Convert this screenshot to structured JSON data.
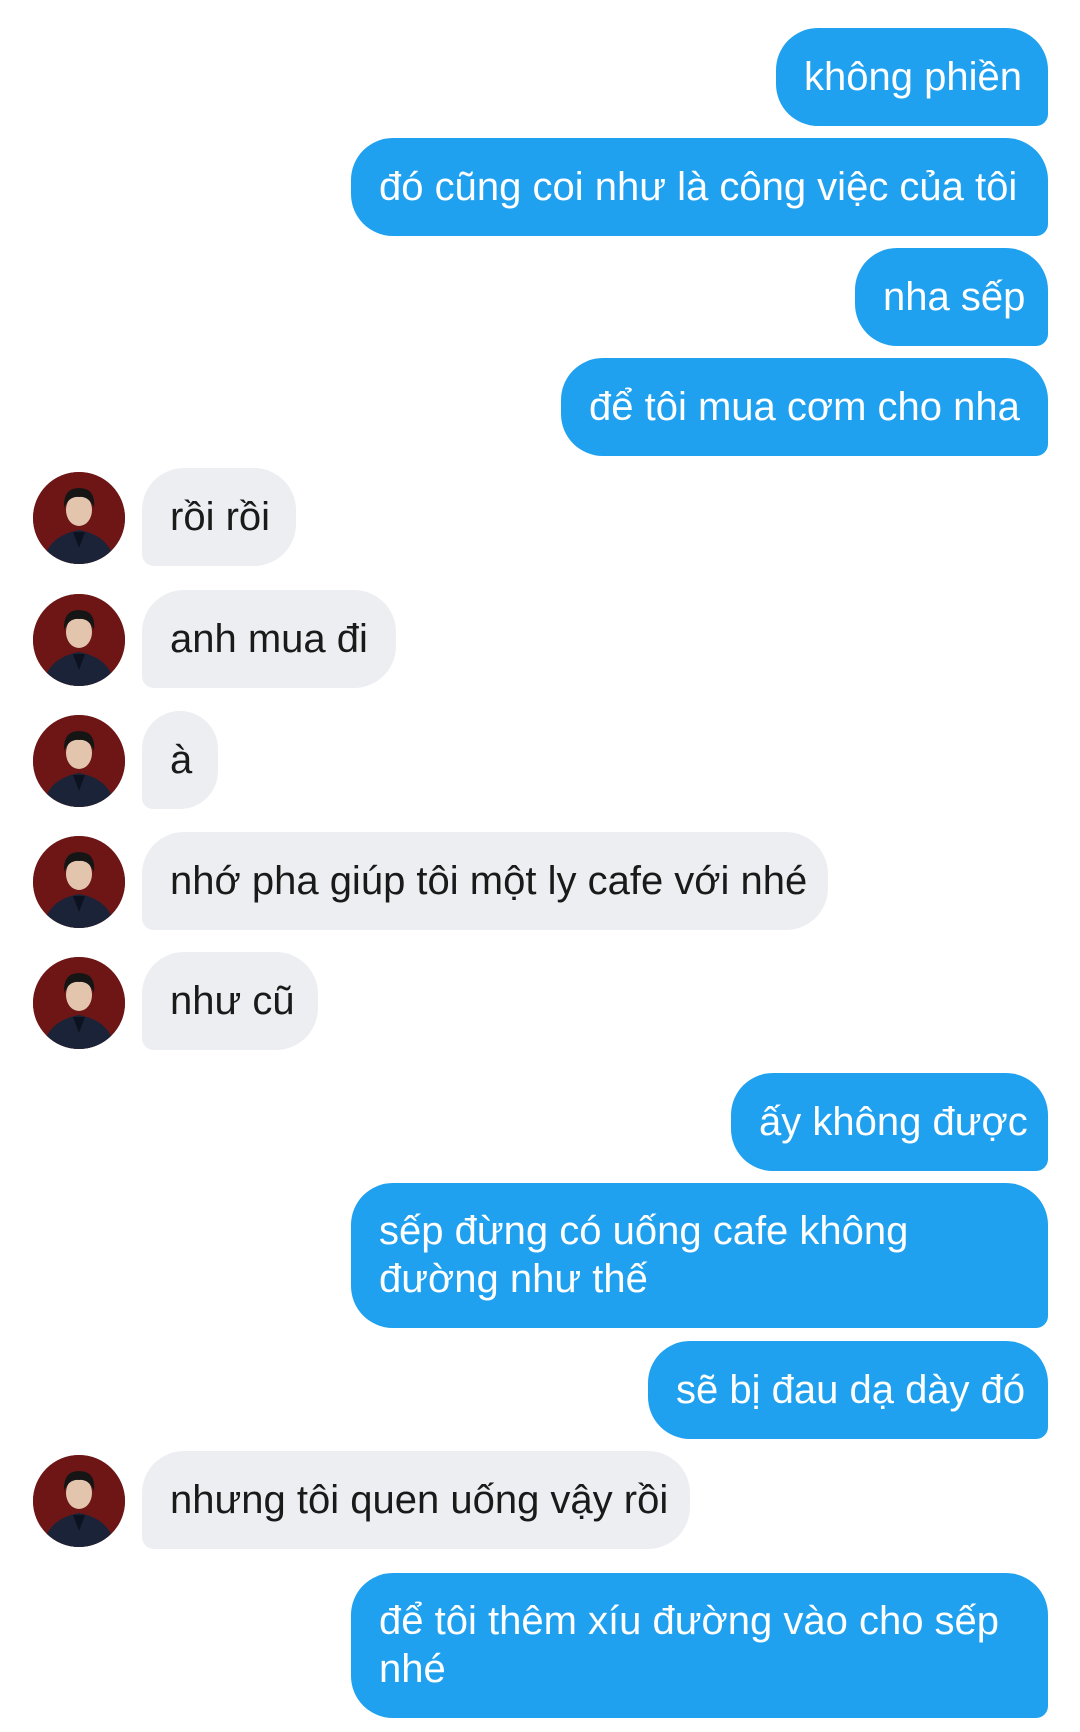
{
  "chat": {
    "messages": [
      {
        "from": "me",
        "text": "không phiền"
      },
      {
        "from": "me",
        "text": "đó cũng coi như là công việc của tôi"
      },
      {
        "from": "me",
        "text": "nha sếp"
      },
      {
        "from": "me",
        "text": "để tôi mua cơm cho nha"
      },
      {
        "from": "them",
        "text": "rồi rồi"
      },
      {
        "from": "them",
        "text": "anh mua đi"
      },
      {
        "from": "them",
        "text": "à"
      },
      {
        "from": "them",
        "text": "nhớ pha giúp tôi một ly cafe với nhé"
      },
      {
        "from": "them",
        "text": "như cũ"
      },
      {
        "from": "me",
        "text": "ấy không được"
      },
      {
        "from": "me",
        "text": "sếp đừng có uống cafe không đường như thế"
      },
      {
        "from": "me",
        "text": "sẽ bị đau dạ dày đó"
      },
      {
        "from": "them",
        "text": "nhưng tôi quen uống vậy rồi"
      },
      {
        "from": "me",
        "text": "để tôi thêm xíu đường vào cho sếp nhé"
      }
    ]
  },
  "colors": {
    "outgoing_bubble": "#1fa1f0",
    "incoming_bubble": "#eceef1",
    "avatar_background": "#6e1616"
  },
  "icons": {
    "avatar": "profile-photo-avatar"
  }
}
